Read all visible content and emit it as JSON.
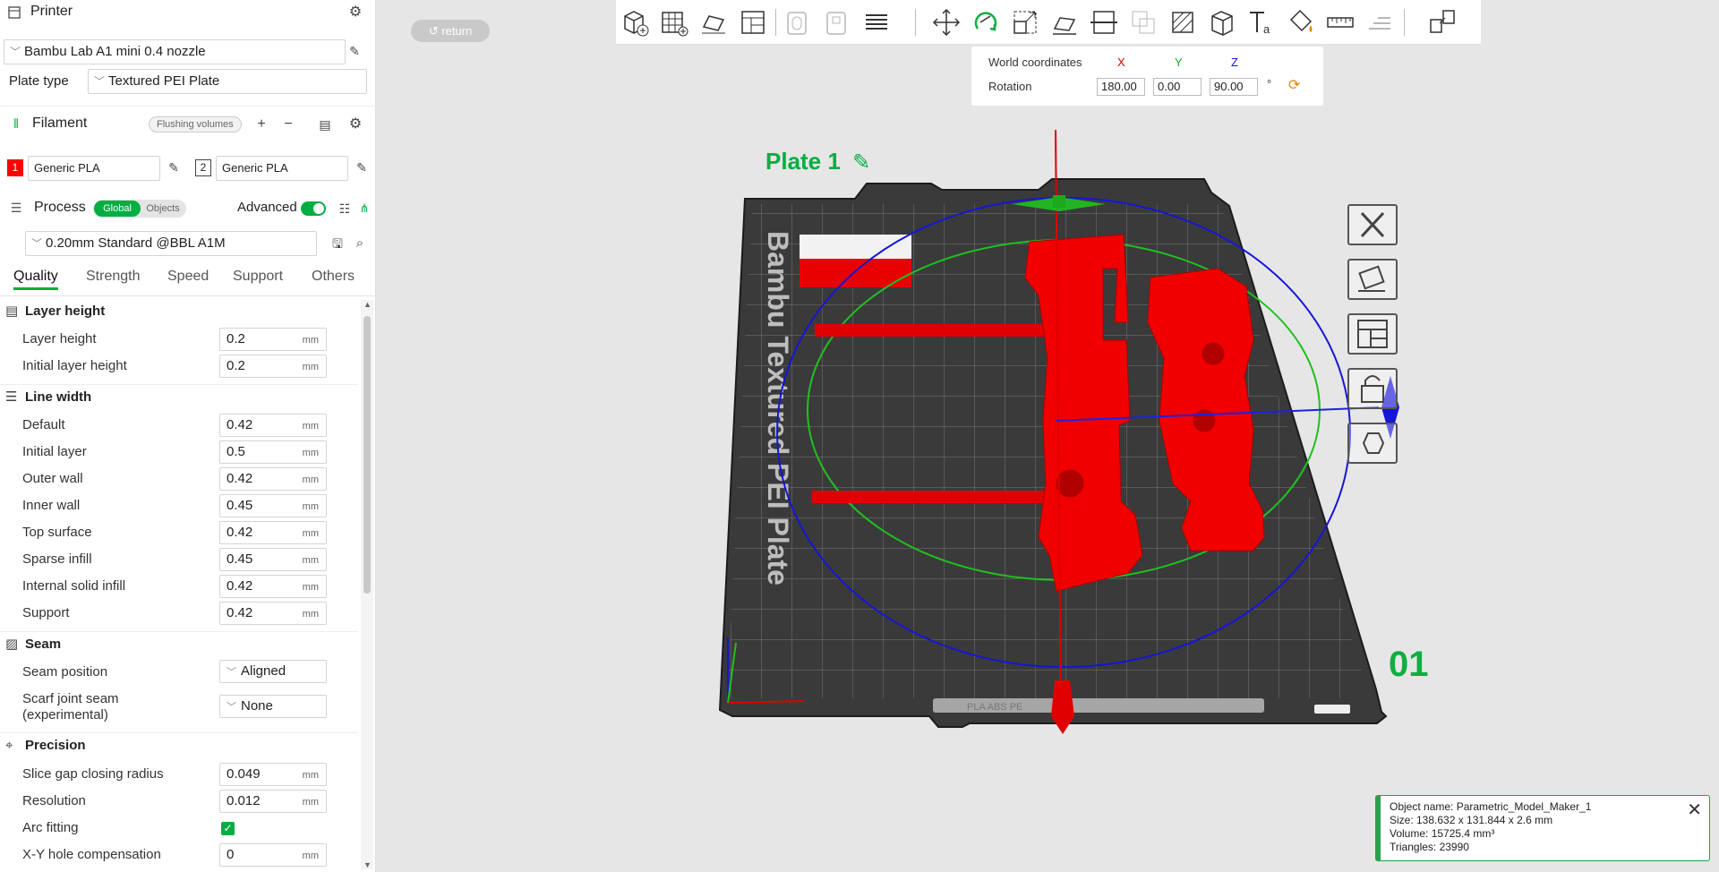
{
  "printer": {
    "title": "Printer",
    "selected": "Bambu Lab A1 mini 0.4 nozzle",
    "plate_type_label": "Plate type",
    "plate_type": "Textured PEI Plate"
  },
  "filament": {
    "title": "Filament",
    "flushing_label": "Flushing volumes",
    "slots": [
      {
        "index": "1",
        "name": "Generic PLA",
        "color": "#ff0000"
      },
      {
        "index": "2",
        "name": "Generic PLA",
        "color": "#ffffff"
      }
    ]
  },
  "process": {
    "title": "Process",
    "toggle_global": "Global",
    "toggle_objects": "Objects",
    "advanced_label": "Advanced",
    "preset": "0.20mm Standard @BBL A1M"
  },
  "tabs": [
    "Quality",
    "Strength",
    "Speed",
    "Support",
    "Others"
  ],
  "settings": {
    "layer_height_group": "Layer height",
    "layer_height_label": "Layer height",
    "layer_height": "0.2",
    "initial_layer_height_label": "Initial layer height",
    "initial_layer_height": "0.2",
    "line_width_group": "Line width",
    "lw_default_label": "Default",
    "lw_default": "0.42",
    "lw_initial_label": "Initial layer",
    "lw_initial": "0.5",
    "lw_outer_label": "Outer wall",
    "lw_outer": "0.42",
    "lw_inner_label": "Inner wall",
    "lw_inner": "0.45",
    "lw_top_label": "Top surface",
    "lw_top": "0.42",
    "lw_sparse_label": "Sparse infill",
    "lw_sparse": "0.45",
    "lw_internal_label": "Internal solid infill",
    "lw_internal": "0.42",
    "lw_support_label": "Support",
    "lw_support": "0.42",
    "seam_group": "Seam",
    "seam_position_label": "Seam position",
    "seam_position": "Aligned",
    "scarf_label_1": "Scarf joint seam",
    "scarf_label_2": "(experimental)",
    "scarf": "None",
    "precision_group": "Precision",
    "slice_gap_label": "Slice gap closing radius",
    "slice_gap": "0.049",
    "resolution_label": "Resolution",
    "resolution": "0.012",
    "arc_fitting_label": "Arc fitting",
    "arc_fitting": true,
    "xy_hole_label": "X-Y hole compensation",
    "xy_hole": "0",
    "unit": "mm"
  },
  "viewport": {
    "return_label": "return",
    "plate_name": "Plate 1",
    "plate_number": "01",
    "bed_text": "Bambu Textured PEI Plate",
    "coords": {
      "world_label": "World coordinates",
      "x_label": "X",
      "y_label": "Y",
      "z_label": "Z",
      "rotation_label": "Rotation",
      "rx": "180.00",
      "ry": "0.00",
      "rz": "90.00",
      "deg": "°"
    },
    "object_info": {
      "name": "Object name: Parametric_Model_Maker_1",
      "size": "Size: 138.632 x 131.844 x 2.6 mm",
      "volume": "Volume: 15725.4 mm³",
      "triangles": "Triangles: 23990"
    }
  },
  "colors": {
    "accent": "#00ae42",
    "model": "#ff0000",
    "bed": "#3c3c3c"
  }
}
